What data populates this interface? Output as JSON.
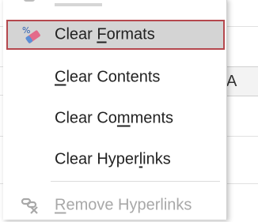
{
  "menu": {
    "items": [
      {
        "label_before": "Clear ",
        "label_accel": "F",
        "label_after": "ormats",
        "icon": "clear-formats-icon",
        "highlighted": true
      },
      {
        "label_before": "",
        "label_accel": "C",
        "label_after": "lear Contents",
        "icon": null
      },
      {
        "label_before": "Clear Co",
        "label_accel": "m",
        "label_after": "ments",
        "icon": null
      },
      {
        "label_before": "Clear Hyper",
        "label_accel": "l",
        "label_after": "inks",
        "icon": null
      },
      {
        "label_before": "",
        "label_accel": "R",
        "label_after": "emove Hyperlinks",
        "icon": "remove-hyperlink-icon",
        "disabled": true
      }
    ]
  },
  "sheet": {
    "column_header_text": "A"
  },
  "colors": {
    "highlight_bg": "#d4d4d4",
    "highlight_border": "#b5484e",
    "disabled_text": "#a8a8a8",
    "icon_pink": "#e36b8a"
  }
}
